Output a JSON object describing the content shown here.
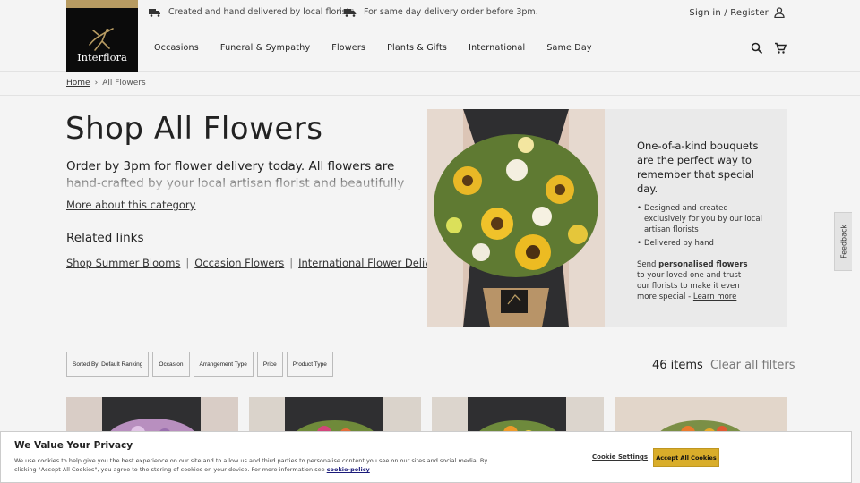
{
  "header": {
    "promo_1": "Created and hand delivered by local florists.",
    "promo_2": "For same day delivery order before 3pm.",
    "sign_in": "Sign in / Register",
    "logo_text": "Interflora"
  },
  "nav": {
    "items": [
      "Occasions",
      "Funeral & Sympathy",
      "Flowers",
      "Plants & Gifts",
      "International",
      "Same Day"
    ]
  },
  "breadcrumb": {
    "home": "Home",
    "sep": "›",
    "current": "All Flowers"
  },
  "hero": {
    "title": "Shop All Flowers",
    "intro": "Order by 3pm for flower delivery today. All flowers are hand-crafted by your local artisan florist and beautifully gift-wrapped in",
    "more_link": "More about this category",
    "related_heading": "Related links",
    "related_links": [
      "Shop Summer Blooms",
      "Occasion Flowers",
      "International Flower Delivery"
    ],
    "panel_heading": "One-of-a-kind bouquets are the perfect way to remember that special day.",
    "panel_bullets": [
      "Designed and created exclusively for you by our local artisan florists",
      "Delivered by hand"
    ],
    "send_prefix": "Send",
    "send_bold": "personalised flowers",
    "send_suffix": "to your loved one and trust our florists to make it even more special -",
    "learn_more": "Learn more"
  },
  "feedback": "Feedback",
  "filters": {
    "buttons": [
      "Sorted By: Default Ranking",
      "Occasion",
      "Arrangement Type",
      "Price",
      "Product Type"
    ],
    "count": "46 items",
    "clear": "Clear all filters"
  },
  "cookie": {
    "title": "We Value Your Privacy",
    "text": "We use cookies to help give you the best experience on our site and to allow us and third parties to personalise content you see on our sites and social media. By clicking \"Accept All Cookies\", you agree to the storing of cookies on your device. For more information see",
    "policy_link": "cookie-policy",
    "settings": "Cookie Settings",
    "accept": "Accept All Cookies"
  },
  "colors": {
    "accent_gold": "#b79b62",
    "accept_button": "#d9ad2a",
    "logo_bg": "#0b0b0b"
  }
}
